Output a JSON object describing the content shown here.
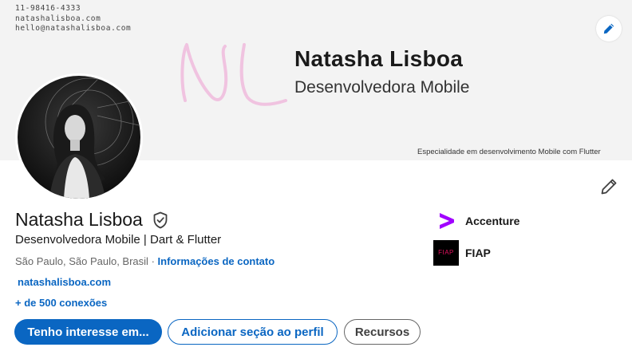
{
  "banner": {
    "contact_lines": [
      "11-98416-4333",
      "natashalisboa.com",
      "hello@natashalisboa.com"
    ],
    "monogram": "NL",
    "name": "Natasha Lisboa",
    "role": "Desenvolvedora Mobile",
    "specialty": "Especialidade em desenvolvimento Mobile com Flutter",
    "edit_icon": "pencil-icon"
  },
  "profile": {
    "name": "Natasha Lisboa",
    "verified_icon": "verified-shield-icon",
    "headline": "Desenvolvedora Mobile | Dart & Flutter",
    "location": "São Paulo, São Paulo, Brasil",
    "separator": "·",
    "contact_info_link": "Informações de contato",
    "website": "natashalisboa.com",
    "connections": "+ de 500 conexões",
    "edit_icon": "pencil-icon"
  },
  "actions": {
    "primary": "Tenho interesse em...",
    "add_section": "Adicionar seção ao perfil",
    "resources": "Recursos"
  },
  "organizations": [
    {
      "name": "Accenture",
      "logo_icon": "accenture-chevron-icon"
    },
    {
      "name": "FIAP",
      "logo_text": "FIAP"
    }
  ],
  "colors": {
    "link_blue": "#0a66c2",
    "banner_bg": "#f3f3f3",
    "monogram_pink": "#f0c3e0",
    "accenture_purple": "#a100ff",
    "fiap_pink": "#e0115f"
  }
}
